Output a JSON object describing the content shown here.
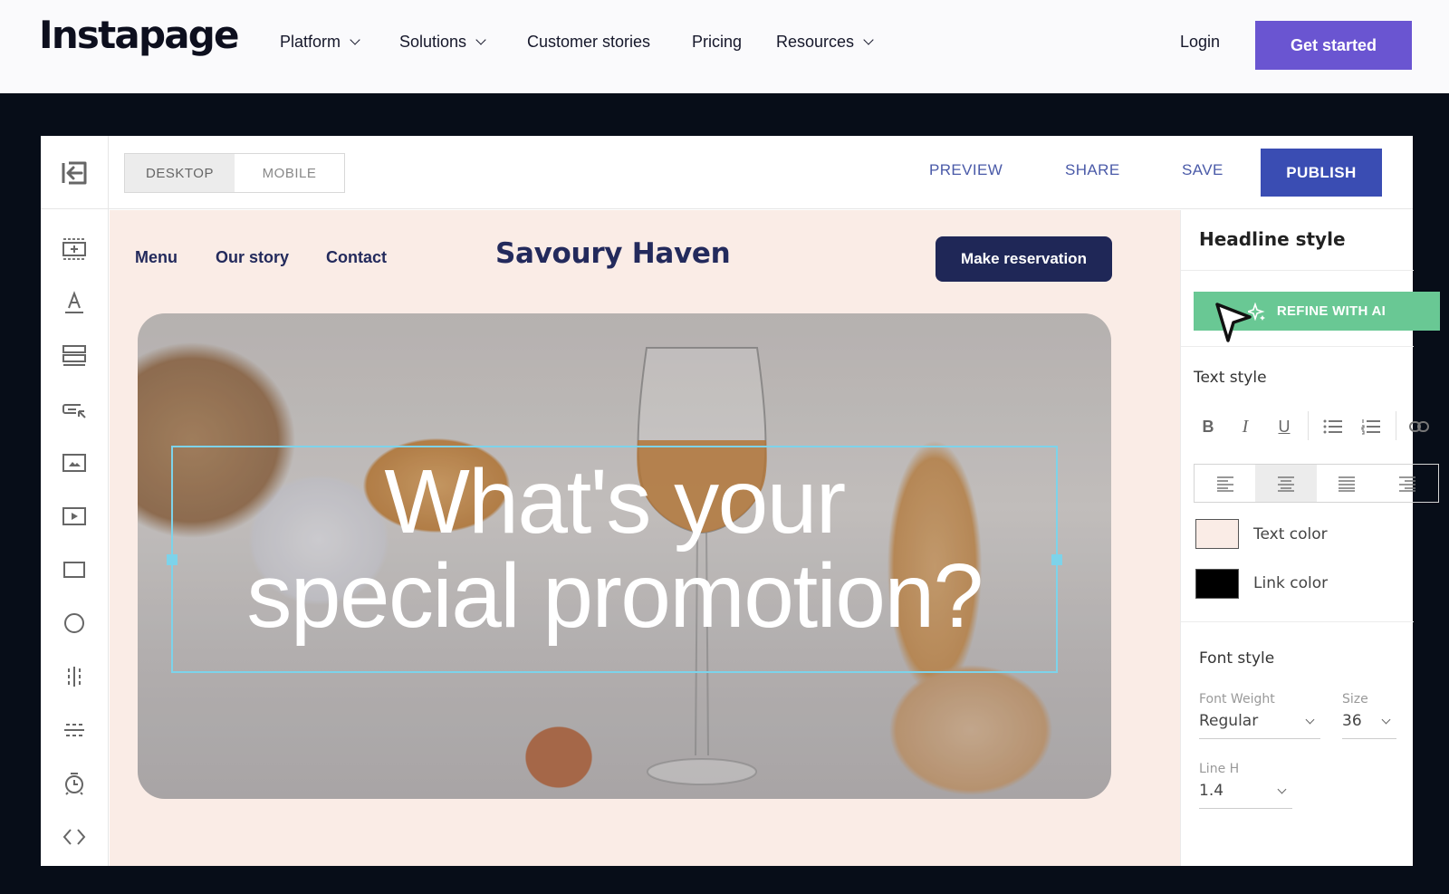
{
  "site_nav": {
    "logo": "Instapage",
    "items": [
      {
        "label": "Platform",
        "has_dropdown": true
      },
      {
        "label": "Solutions",
        "has_dropdown": true
      },
      {
        "label": "Customer stories",
        "has_dropdown": false
      },
      {
        "label": "Pricing",
        "has_dropdown": false
      },
      {
        "label": "Resources",
        "has_dropdown": true
      }
    ],
    "login": "Login",
    "cta": "Get started",
    "cta_color": "#6a55d1"
  },
  "editor": {
    "exit_icon": "exit-arrow-icon",
    "device_toggle": {
      "options": [
        "DESKTOP",
        "MOBILE"
      ],
      "selected": "DESKTOP"
    },
    "actions": {
      "preview": "PREVIEW",
      "share": "SHARE",
      "save": "SAVE",
      "publish": "PUBLISH"
    },
    "publish_color": "#3a4db3",
    "tools": [
      "add-section-icon",
      "text-icon",
      "form-icon",
      "button-icon",
      "image-icon",
      "video-icon",
      "box-icon",
      "circle-icon",
      "vertical-divider-icon",
      "horizontal-divider-icon",
      "timer-icon",
      "code-icon"
    ]
  },
  "landing_page": {
    "nav_links": [
      "Menu",
      "Our story",
      "Contact"
    ],
    "brand": "Savoury Haven",
    "cta": "Make reservation",
    "headline_lines": [
      "What's your",
      "special promotion?"
    ],
    "background_color": "#faece6",
    "brand_color": "#232a5c"
  },
  "style_panel": {
    "title": "Headline style",
    "refine_button": "REFINE WITH AI",
    "refine_color": "#69c894",
    "text_style": {
      "label": "Text style",
      "format_buttons": [
        "bold",
        "italic",
        "underline",
        "bulleted-list",
        "numbered-list",
        "link"
      ],
      "alignments": [
        "left",
        "center",
        "justify",
        "right"
      ],
      "selected_alignment": "center"
    },
    "colors": [
      {
        "label": "Text color",
        "value": "#faece6"
      },
      {
        "label": "Link color",
        "value": "#000000"
      }
    ],
    "font_style": {
      "label": "Font style",
      "weight_label": "Font Weight",
      "weight_value": "Regular",
      "size_label": "Size",
      "size_value": "36",
      "line_height_label": "Line H",
      "line_height_value": "1.4"
    }
  }
}
